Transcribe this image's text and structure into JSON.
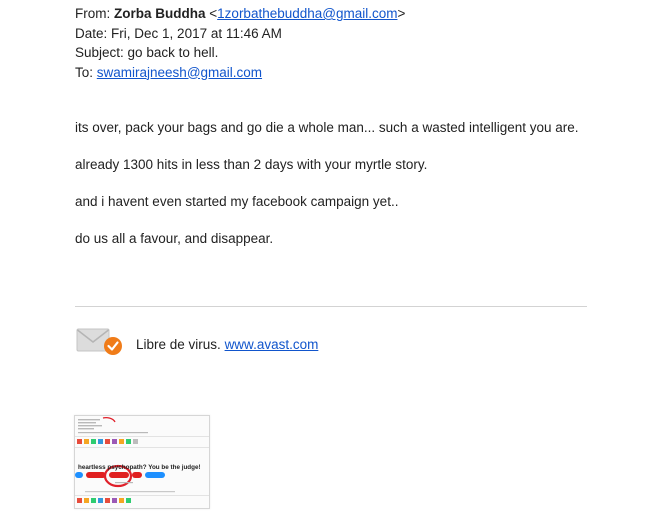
{
  "email": {
    "from_label": "From:",
    "from_name": "Zorba Buddha",
    "from_email": "1zorbathebuddha@gmail.com",
    "date_label": "Date:",
    "date_value": "Fri, Dec 1, 2017 at 11:46 AM",
    "subject_label": "Subject:",
    "subject_value": "go back to hell.",
    "to_label": "To:",
    "to_email": "swamirajneesh@gmail.com",
    "body": [
      "its over, pack your bags and go die a whole man... such a wasted intelligent you are.",
      "already 1300 hits in less than 2 days with your myrtle story.",
      "and i havent even started my facebook campaign yet..",
      "do us all a favour, and disappear."
    ]
  },
  "signature": {
    "text": "Libre de virus.",
    "link": "www.avast.com",
    "icon": "avast-envelope-check-icon",
    "badge_color": "#f07c19"
  },
  "attachment": {
    "caption": "heartless psychopath? You be the judge!"
  },
  "colors": {
    "link": "#1155cc",
    "text": "#222222",
    "annotation_circle": "#e0202a"
  }
}
